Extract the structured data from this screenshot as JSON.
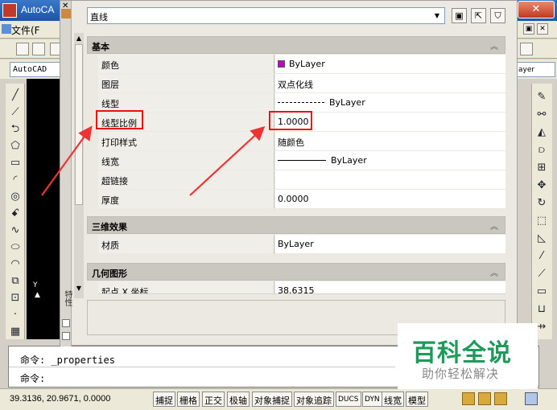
{
  "acad": {
    "title": "AutoCA",
    "menu_file": "文件(F",
    "combo_left": "AutoCAD",
    "combo_right": "ayer",
    "command_lines": [
      "命令: _properties",
      "命令:"
    ],
    "coords": "39.3136, 20.9671, 0.0000",
    "status_buttons": [
      "捕捉",
      "栅格",
      "正交",
      "极轴",
      "对象捕捉",
      "对象追踪",
      "DUCS",
      "DYN",
      "线宽",
      "模型"
    ]
  },
  "palette": {
    "object_select": "直线",
    "categories": {
      "general": "基本",
      "3d": "三维效果",
      "geometry": "几何图形"
    },
    "general_rows": [
      {
        "name": "颜色",
        "value": "ByLayer"
      },
      {
        "name": "图层",
        "value": "双点化线"
      },
      {
        "name": "线型",
        "value": "ByLayer"
      },
      {
        "name": "线型比例",
        "value": "1.0000"
      },
      {
        "name": "打印样式",
        "value": "随颜色"
      },
      {
        "name": "线宽",
        "value": "ByLayer"
      },
      {
        "name": "超链接",
        "value": ""
      },
      {
        "name": "厚度",
        "value": "0.0000"
      }
    ],
    "3d_rows": [
      {
        "name": "材质",
        "value": "ByLayer"
      }
    ],
    "geometry_rows": [
      {
        "name": "起点 X 坐标",
        "value": "38.6315"
      }
    ],
    "side_label": "特性"
  },
  "colors": {
    "highlight": "#e11111",
    "color_swatch": "#c000c0",
    "watermark_green": "#1f9a5a"
  },
  "watermark": {
    "line1": "百科全说",
    "line2": "助你轻松解决"
  }
}
